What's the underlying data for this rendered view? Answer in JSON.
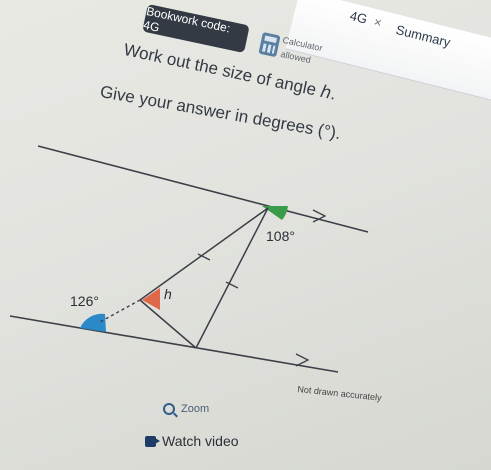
{
  "header": {
    "bookwork_code": "Bookwork code: 4G",
    "calculator_line1": "Calculator",
    "calculator_line2": "allowed",
    "tab_code": "4G",
    "tab_close": "×",
    "summary_tab": "Summary"
  },
  "question": {
    "line1": "Work out the size of angle ℎ.",
    "line2": "Give your answer in degrees (°)."
  },
  "diagram": {
    "angle_top": "108°",
    "angle_left": "126°",
    "angle_unknown": "h",
    "note": "Not drawn accurately",
    "colors": {
      "top_angle": "#3a9b4a",
      "left_angle": "#2b89c9",
      "unknown_angle": "#e0684a"
    }
  },
  "actions": {
    "zoom_label": "Zoom",
    "watch_video_label": "Watch video"
  }
}
